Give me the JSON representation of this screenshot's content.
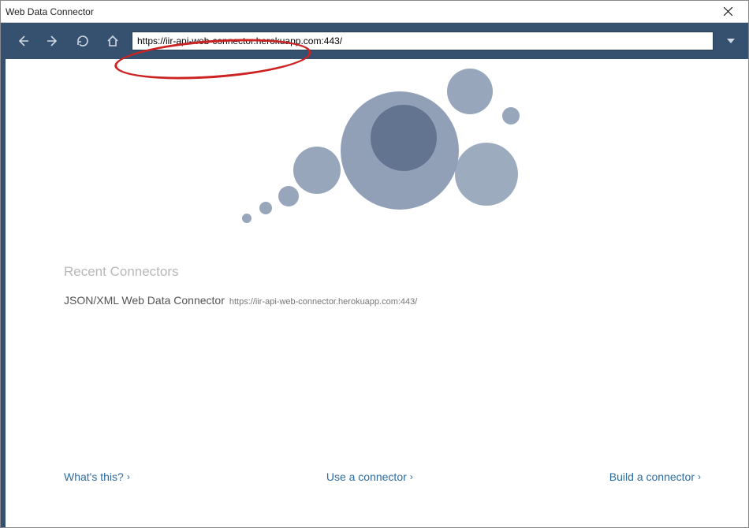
{
  "window": {
    "title": "Web Data Connector"
  },
  "navbar": {
    "url_value": "https://iir-api-web-connector.herokuapp.com:443/"
  },
  "recent": {
    "heading": "Recent Connectors",
    "items": [
      {
        "name": "JSON/XML Web Data Connector",
        "url": "https://iir-api-web-connector.herokuapp.com:443/"
      }
    ]
  },
  "footer": {
    "whats_this": "What's this?",
    "use_connector": "Use a connector",
    "build_connector": "Build a connector",
    "chevron": "›"
  },
  "colors": {
    "navbar_bg": "#35516f",
    "link": "#2d6ca2",
    "annotation": "#cc2222"
  }
}
